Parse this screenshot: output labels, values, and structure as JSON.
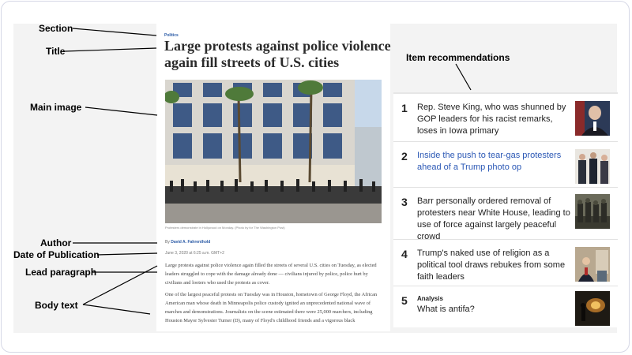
{
  "labels": {
    "section": "Section",
    "title": "Title",
    "main_image": "Main image",
    "author": "Author",
    "date": "Date of Publication",
    "lead": "Lead paragraph",
    "body": "Body text",
    "recs": "Item recommendations"
  },
  "article": {
    "section": "Politics",
    "title": "Large protests against police violence again fill streets of U.S. cities",
    "caption": "Protesters demonstrate in Hollywood on Monday. (Photo by for The Washington Post)",
    "author_prefix": "By",
    "author_name": "David A. Fahrenthold",
    "date": "June 3, 2020 at 6:25 a.m. GMT+2",
    "lead": "Large protests against police violence again filled the streets of several U.S. cities on Tuesday, as elected leaders struggled to cope with the damage already done — civilians injured by police, police hurt by civilians and looters who used the protests as cover.",
    "body": "One of the largest peaceful protests on Tuesday was in Houston, hometown of George Floyd, the African American man whose death in Minneapolis police custody ignited an unprecedented national wave of marches and demonstrations. Journalists on the scene estimated there were 25,000 marchers, including Houston Mayor Sylvester Turner (D), many of Floyd's childhood friends and a vigorous black"
  },
  "recommendations": [
    {
      "num": "1",
      "text": "Rep. Steve King, who was shunned by GOP leaders for his racist remarks, loses in Iowa primary",
      "kicker": ""
    },
    {
      "num": "2",
      "text": "Inside the push to tear-gas protesters ahead of a Trump photo op",
      "kicker": ""
    },
    {
      "num": "3",
      "text": "Barr personally ordered removal of protesters near White House, leading to use of force against largely peaceful crowd",
      "kicker": ""
    },
    {
      "num": "4",
      "text": "Trump's naked use of religion as a political tool draws rebukes from some faith leaders",
      "kicker": ""
    },
    {
      "num": "5",
      "text": "What is antifa?",
      "kicker": "Analysis"
    }
  ]
}
